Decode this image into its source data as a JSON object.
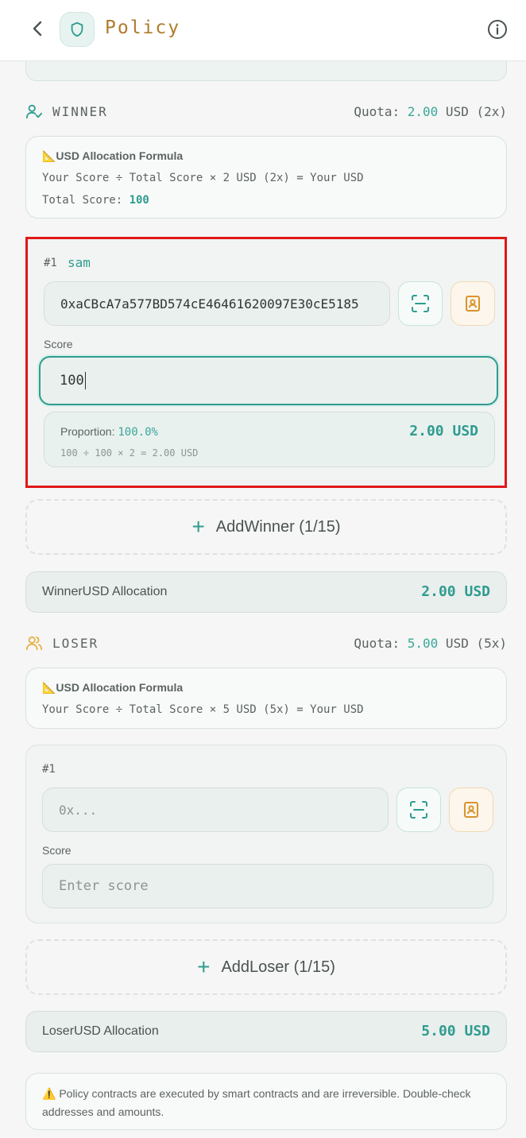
{
  "header": {
    "title": "Policy"
  },
  "winner": {
    "label": "WINNER",
    "quota_label": "Quota: ",
    "quota_value": "2.00",
    "quota_suffix": " USD (2x)",
    "formula_title": "📐USD Allocation Formula",
    "formula_line": "Your Score ÷ Total Score × 2 USD (2x) = Your USD",
    "total_score_label": "Total Score: ",
    "total_score_value": "100",
    "entries": [
      {
        "index": "#1",
        "name": "sam",
        "address": "0xaCBcA7a577BD574cE46461620097E30cE5185",
        "score_label": "Score",
        "score": "100",
        "proportion_label": "Proportion: ",
        "proportion_value": "100.0%",
        "amount": "2.00 USD",
        "equation": "100 ÷ 100 × 2 = 2.00 USD"
      }
    ],
    "add_label": "AddWinner (1/15)",
    "allocation_label": "WinnerUSD Allocation",
    "allocation_value": "2.00 USD"
  },
  "loser": {
    "label": "LOSER",
    "quota_label": "Quota: ",
    "quota_value": "5.00",
    "quota_suffix": " USD (5x)",
    "formula_title": "📐USD Allocation Formula",
    "formula_line": "Your Score ÷ Total Score × 5 USD (5x) = Your USD",
    "entries": [
      {
        "index": "#1",
        "address_placeholder": "0x...",
        "score_label": "Score",
        "score_placeholder": "Enter score"
      }
    ],
    "add_label": "AddLoser (1/15)",
    "allocation_label": "LoserUSD Allocation",
    "allocation_value": "5.00 USD"
  },
  "warning": "⚠️ Policy contracts are executed by smart contracts and are irreversible. Double-check addresses and amounts.",
  "colors": {
    "accent": "#2f9c8f",
    "brand_title": "#b07b2c",
    "highlight": "#e01818",
    "loser_icon": "#e8b04a"
  }
}
